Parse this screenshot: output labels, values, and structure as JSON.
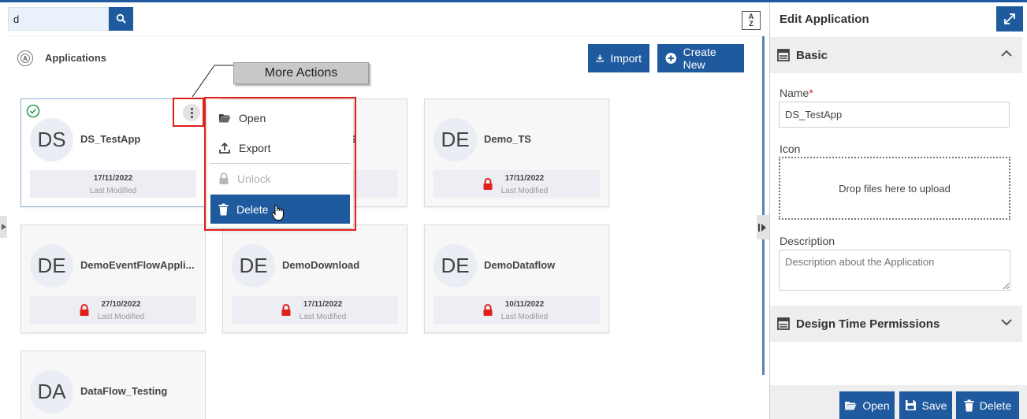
{
  "search": {
    "value": "d",
    "placeholder": ""
  },
  "header": {
    "title": "Applications",
    "import_label": "Import",
    "create_label": "Create New",
    "sort_label_top": "A",
    "sort_label_bottom": "Z"
  },
  "callout": {
    "text": "More Actions"
  },
  "cards": [
    {
      "initials": "DS",
      "name": "DS_TestApp",
      "date": "17/11/2022",
      "modified_label": "Last Modified",
      "locked": false,
      "selected": true
    },
    {
      "initials": "",
      "name": "S",
      "date": "",
      "modified_label": "",
      "locked": false,
      "selected": false
    },
    {
      "initials": "DE",
      "name": "Demo_TS",
      "date": "17/11/2022",
      "modified_label": "Last Modified",
      "locked": true,
      "selected": false
    },
    {
      "initials": "DE",
      "name": "DemoEventFlowAppli...",
      "date": "27/10/2022",
      "modified_label": "Last Modified",
      "locked": true,
      "selected": false
    },
    {
      "initials": "DE",
      "name": "DemoDownload",
      "date": "17/11/2022",
      "modified_label": "Last Modified",
      "locked": true,
      "selected": false
    },
    {
      "initials": "DE",
      "name": "DemoDataflow",
      "date": "10/11/2022",
      "modified_label": "Last Modified",
      "locked": true,
      "selected": false
    },
    {
      "initials": "DA",
      "name": "DataFlow_Testing",
      "date": "",
      "modified_label": "",
      "locked": false,
      "selected": false
    }
  ],
  "menu": {
    "items": [
      {
        "label": "Open",
        "icon": "folder-open-icon",
        "state": "normal"
      },
      {
        "label": "Export",
        "icon": "export-icon",
        "state": "normal"
      },
      {
        "label": "Unlock",
        "icon": "lock-icon",
        "state": "disabled"
      },
      {
        "label": "Delete",
        "icon": "trash-icon",
        "state": "active"
      }
    ]
  },
  "panel": {
    "title": "Edit Application",
    "basic_section": "Basic",
    "name_label": "Name",
    "name_required_mark": "*",
    "name_value": "DS_TestApp",
    "icon_label": "Icon",
    "dropzone_text": "Drop files here to upload",
    "description_label": "Description",
    "description_placeholder": "Description about the Application",
    "permissions_section": "Design Time Permissions",
    "buttons": {
      "open": "Open",
      "save": "Save",
      "delete": "Delete"
    }
  },
  "colors": {
    "primary": "#1f5a9e",
    "danger": "#e0201a",
    "lock": "#e0201a",
    "check": "#2e9e5b"
  }
}
